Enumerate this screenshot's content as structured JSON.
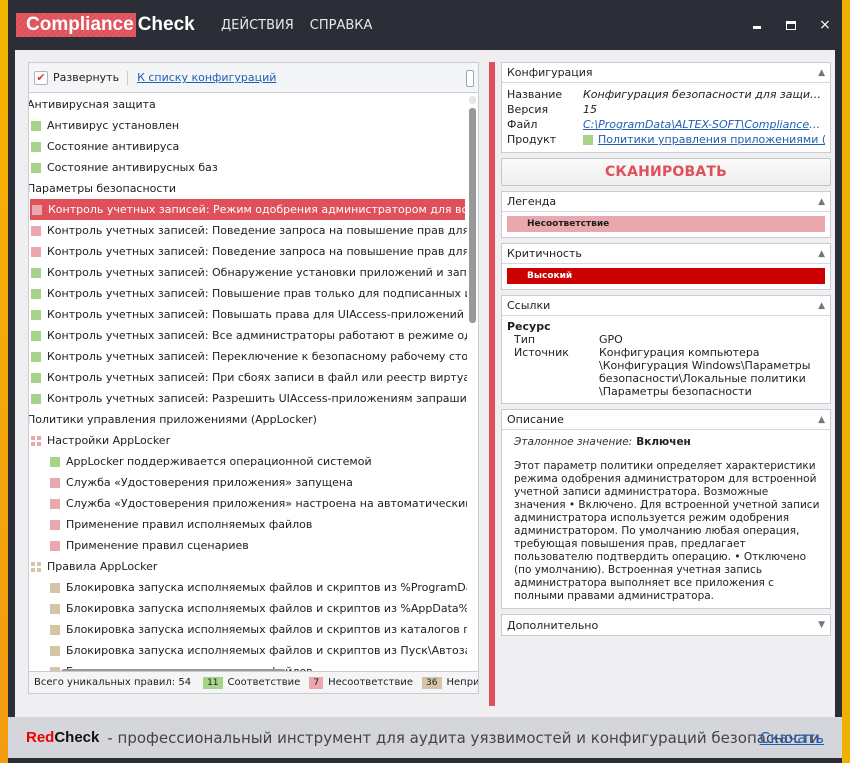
{
  "app": {
    "logo_part1": "Compliance",
    "logo_part2": "Check",
    "menu": [
      "ДЕЙСТВИЯ",
      "СПРАВКА"
    ],
    "window_controls": {
      "minimize": "minimize-icon",
      "maximize": "maximize-icon",
      "close": "×"
    }
  },
  "left": {
    "toolbar": {
      "expand_label": "Развернуть",
      "expand_checked": true,
      "check_glyph": "✔",
      "back_link": "К списку конфигураций"
    },
    "tree": [
      {
        "level": "group",
        "label": "Антивирусная защита"
      },
      {
        "level": "l1",
        "status": "ok",
        "label": "Антивирус установлен"
      },
      {
        "level": "l1",
        "status": "ok",
        "label": "Состояние антивируса"
      },
      {
        "level": "l1",
        "status": "ok",
        "label": "Состояние антивирусных баз"
      },
      {
        "level": "group",
        "label": "Параметры безопасности"
      },
      {
        "level": "l1",
        "status": "fail",
        "selected": true,
        "label": "Контроль учетных записей: Режим одобрения администратором для встроенной учетной записи администратора"
      },
      {
        "level": "l1",
        "status": "fail",
        "label": "Контроль учетных записей: Поведение запроса на повышение прав для администраторов"
      },
      {
        "level": "l1",
        "status": "fail",
        "label": "Контроль учетных записей: Поведение запроса на повышение прав для обычных пользователей"
      },
      {
        "level": "l1",
        "status": "ok",
        "label": "Контроль учетных записей: Обнаружение установки приложений и запрос на повышение прав"
      },
      {
        "level": "l1",
        "status": "ok",
        "label": "Контроль учетных записей: Повышение прав только для подписанных и проверенных исполняемых файлов"
      },
      {
        "level": "l1",
        "status": "ok",
        "label": "Контроль учетных записей: Повышать права для UIAccess-приложений только при установке в безопасных местах"
      },
      {
        "level": "l1",
        "status": "ok",
        "label": "Контроль учетных записей: Все администраторы работают в режиме одобрения администратором"
      },
      {
        "level": "l1",
        "status": "ok",
        "label": "Контроль учетных записей: Переключение к безопасному рабочему столу при выполнении запроса"
      },
      {
        "level": "l1",
        "status": "ok",
        "label": "Контроль учетных записей: При сбоях записи в файл или реестр виртуализация в размещение пользователя"
      },
      {
        "level": "l1",
        "status": "ok",
        "label": "Контроль учетных записей: Разрешить UIAccess-приложениям запрашивать повышение прав"
      },
      {
        "level": "group",
        "label": "Политики управления приложениями (AppLocker)"
      },
      {
        "level": "l1",
        "status": "fail",
        "grid": true,
        "label": "Настройки AppLocker"
      },
      {
        "level": "l2",
        "status": "ok",
        "label": "AppLocker поддерживается операционной системой"
      },
      {
        "level": "l2",
        "status": "fail",
        "label": "Служба «Удостоверения приложения» запущена"
      },
      {
        "level": "l2",
        "status": "fail",
        "label": "Служба «Удостоверения приложения» настроена на автоматический запуск"
      },
      {
        "level": "l2",
        "status": "fail",
        "label": "Применение правил исполняемых файлов"
      },
      {
        "level": "l2",
        "status": "fail",
        "label": "Применение правил сценариев"
      },
      {
        "level": "l1",
        "status": "na",
        "grid": true,
        "label": "Правила AppLocker"
      },
      {
        "level": "l2",
        "status": "na",
        "label": "Блокировка запуска исполняемых файлов и скриптов из %ProgramData%"
      },
      {
        "level": "l2",
        "status": "na",
        "label": "Блокировка запуска исполняемых файлов и скриптов из %AppData% и подкаталогов"
      },
      {
        "level": "l2",
        "status": "na",
        "label": "Блокировка запуска исполняемых файлов и скриптов из каталогов профиля"
      },
      {
        "level": "l2",
        "status": "na",
        "label": "Блокировка запуска исполняемых файлов и скриптов из Пуск\\Автозагрузка"
      },
      {
        "level": "l2",
        "status": "na",
        "label": "Блокировка запуска исполняемых файлов"
      }
    ],
    "status_bar": {
      "total_label": "Всего уникальных правил: 54",
      "ok_count": "11",
      "ok_label": "Соответствие",
      "fail_count": "7",
      "fail_label": "Несоответствие",
      "na_count": "36",
      "na_label": "Неприменимо"
    }
  },
  "right": {
    "config": {
      "title": "Конфигурация",
      "rows": [
        {
          "key": "Название",
          "value": "Конфигурация безопасности для защиты от..."
        },
        {
          "key": "Версия",
          "value": "15"
        },
        {
          "key": "Файл",
          "value": "C:\\ProgramData\\ALTEX-SOFT\\ComplianceCheck..."
        },
        {
          "key": "Продукт",
          "value": "Политики управления приложениями (A..."
        }
      ]
    },
    "scan_button": "СКАНИРОВАТЬ",
    "legend": {
      "title": "Легенда",
      "value": "Несоответствие"
    },
    "criticality": {
      "title": "Критичность",
      "value": "Высокий"
    },
    "links": {
      "title": "Ссылки",
      "resource_label": "Ресурс",
      "type_label": "Тип",
      "type_value": "GPO",
      "source_label": "Источник",
      "source_value": [
        "Конфигурация компьютера",
        "\\Конфигурация Windows\\Параметры",
        "безопасности\\Локальные политики",
        "\\Параметры безопасности"
      ]
    },
    "description": {
      "title": "Описание",
      "reference_label": "Эталонное значение:",
      "reference_value": "Включен",
      "text": " Этот параметр политики определяет характеристики режима одобрения администратором для встроенной учетной записи администратора. Возможные значения • Включено. Для встроенной учетной записи администратора используется режим одобрения администратором. По умолчанию любая операция, требующая повышения прав, предлагает пользователю подтвердить операцию. • Отключено (по умолчанию). Встроенная учетная запись администратора выполняет все приложения с полными правами администратора."
    },
    "additional": {
      "title": "Дополнительно"
    }
  },
  "footer": {
    "brand_red": "Red",
    "brand_dark": "Check",
    "tagline": "- профессиональный инструмент для аудита уязвимостей и конфигураций безопасности",
    "download": "Скачать"
  },
  "colors": {
    "accent": "#e0505a",
    "ok": "#a6d38a",
    "fail": "#eaa7ad",
    "na": "#d6c5a4",
    "critical": "#cc0000",
    "link": "#1f5fb4"
  }
}
